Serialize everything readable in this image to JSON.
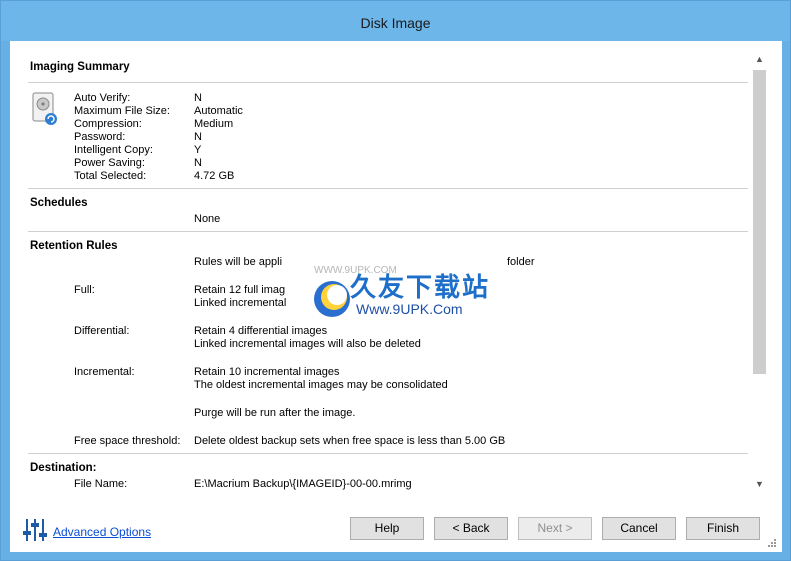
{
  "window": {
    "title": "Disk Image"
  },
  "imaging_summary": {
    "heading": "Imaging Summary",
    "rows": [
      {
        "label": "Auto Verify:",
        "value": "N"
      },
      {
        "label": "Maximum File Size:",
        "value": "Automatic"
      },
      {
        "label": "Compression:",
        "value": "Medium"
      },
      {
        "label": "Password:",
        "value": "N"
      },
      {
        "label": "Intelligent Copy:",
        "value": "Y"
      },
      {
        "label": "Power Saving:",
        "value": "N"
      },
      {
        "label": "Total Selected:",
        "value": "4.72 GB"
      }
    ]
  },
  "schedules": {
    "heading": "Schedules",
    "value": "None"
  },
  "retention": {
    "heading": "Retention Rules",
    "intro": "Rules will be appli",
    "intro_end": "folder",
    "full_label": "Full:",
    "full_line1": "Retain 12 full imag",
    "full_line2": "Linked incremental",
    "diff_label": "Differential:",
    "diff_line1": "Retain 4 differential images",
    "diff_line2": "Linked incremental images will also be deleted",
    "inc_label": "Incremental:",
    "inc_line1": "Retain 10 incremental images",
    "inc_line2": "The oldest incremental images may be consolidated",
    "purge": "Purge will be run after the image.",
    "free_label": "Free space threshold:",
    "free_value": "Delete oldest backup sets when free space is less than 5.00 GB"
  },
  "destination": {
    "heading": "Destination:",
    "file_label": "File Name:",
    "file_value": "E:\\Macrium Backup\\{IMAGEID}-00-00.mrimg"
  },
  "watermark": {
    "cn": "久友下载站",
    "url": "Www.9UPK.Com",
    "url_faint": "WWW.9UPK.COM"
  },
  "footer": {
    "advanced_options": "Advanced Options",
    "help": "Help",
    "back": "< Back",
    "next": "Next >",
    "cancel": "Cancel",
    "finish": "Finish"
  }
}
